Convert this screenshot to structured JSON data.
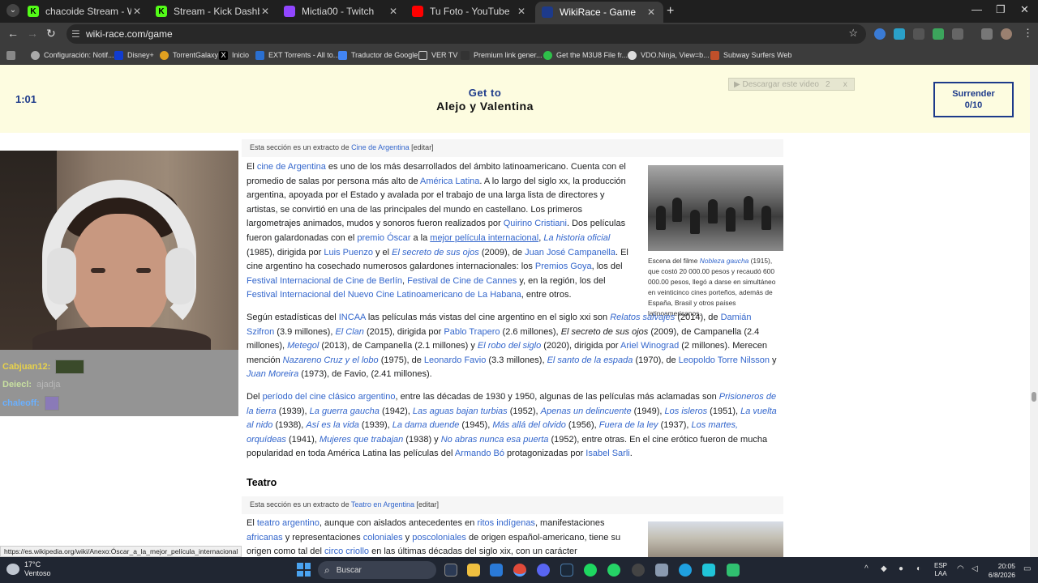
{
  "browser": {
    "tabs": [
      {
        "label": "chacoide Stream - Watch Live o",
        "icon": "kick-icon",
        "color": "#53fc18"
      },
      {
        "label": "Stream - Kick Dashboard",
        "icon": "kick-icon",
        "color": "#53fc18"
      },
      {
        "label": "Mictia00 - Twitch",
        "icon": "twitch-icon",
        "color": "#9146ff"
      },
      {
        "label": "Tu Foto - YouTube",
        "icon": "youtube-icon",
        "color": "#ff0000"
      },
      {
        "label": "WikiRace - Game",
        "icon": "wikirace-icon",
        "color": "#1d3a8a"
      }
    ],
    "url": "wiki-race.com/game",
    "bookmarks": [
      "Configuración: Notif...",
      "Disney+",
      "TorrentGalaxy",
      "Inicio",
      "EXT Torrents - All to...",
      "Traductor de Google",
      "VER TV",
      "Premium link gener...",
      "Get the M3U8 File fr...",
      "VDO.Ninja, View=b...",
      "Subway Surfers Web"
    ]
  },
  "game": {
    "timer": "1:01",
    "goal_label": "Get to",
    "goal_target": "Alejo y Valentina",
    "download_bar": "▶ Descargar este video",
    "download_count": "2",
    "download_close": "x",
    "surrender_label": "Surrender",
    "surrender_count": "0/10"
  },
  "chat": [
    {
      "user": "Cabjuan12:",
      "message": ""
    },
    {
      "user": "Deiecl:",
      "message": "ajadja"
    },
    {
      "user": "chaleoff:",
      "message": ""
    }
  ],
  "article": {
    "excerpt1_prefix": "Esta sección es un extracto de",
    "excerpt1_link": "Cine de Argentina",
    "excerpt1_edit": "[editar]",
    "excerpt2_prefix": "Esta sección es un extracto de",
    "excerpt2_link": "Teatro en Argentina",
    "excerpt2_edit": "[editar]",
    "heading_teatro": "Teatro",
    "figure_caption_prefix": "Escena del filme",
    "figure_caption_link": "Nobleza gaucha",
    "figure_caption_rest": "(1915), que costó 20 000.00 pesos y recaudó 600 000.00 pesos, llegó a darse en simultáneo en veinticinco cines porteños, además de España, Brasil y otros países latinoamericanos."
  },
  "status_url": "https://es.wikipedia.org/wiki/Anexo:Óscar_a_la_mejor_película_internacional",
  "taskbar": {
    "temp": "17°C",
    "weather": "Ventoso",
    "search": "Buscar",
    "lang1": "ESP",
    "lang2": "LAA",
    "time": "20:05",
    "date": "6/8/2026"
  }
}
